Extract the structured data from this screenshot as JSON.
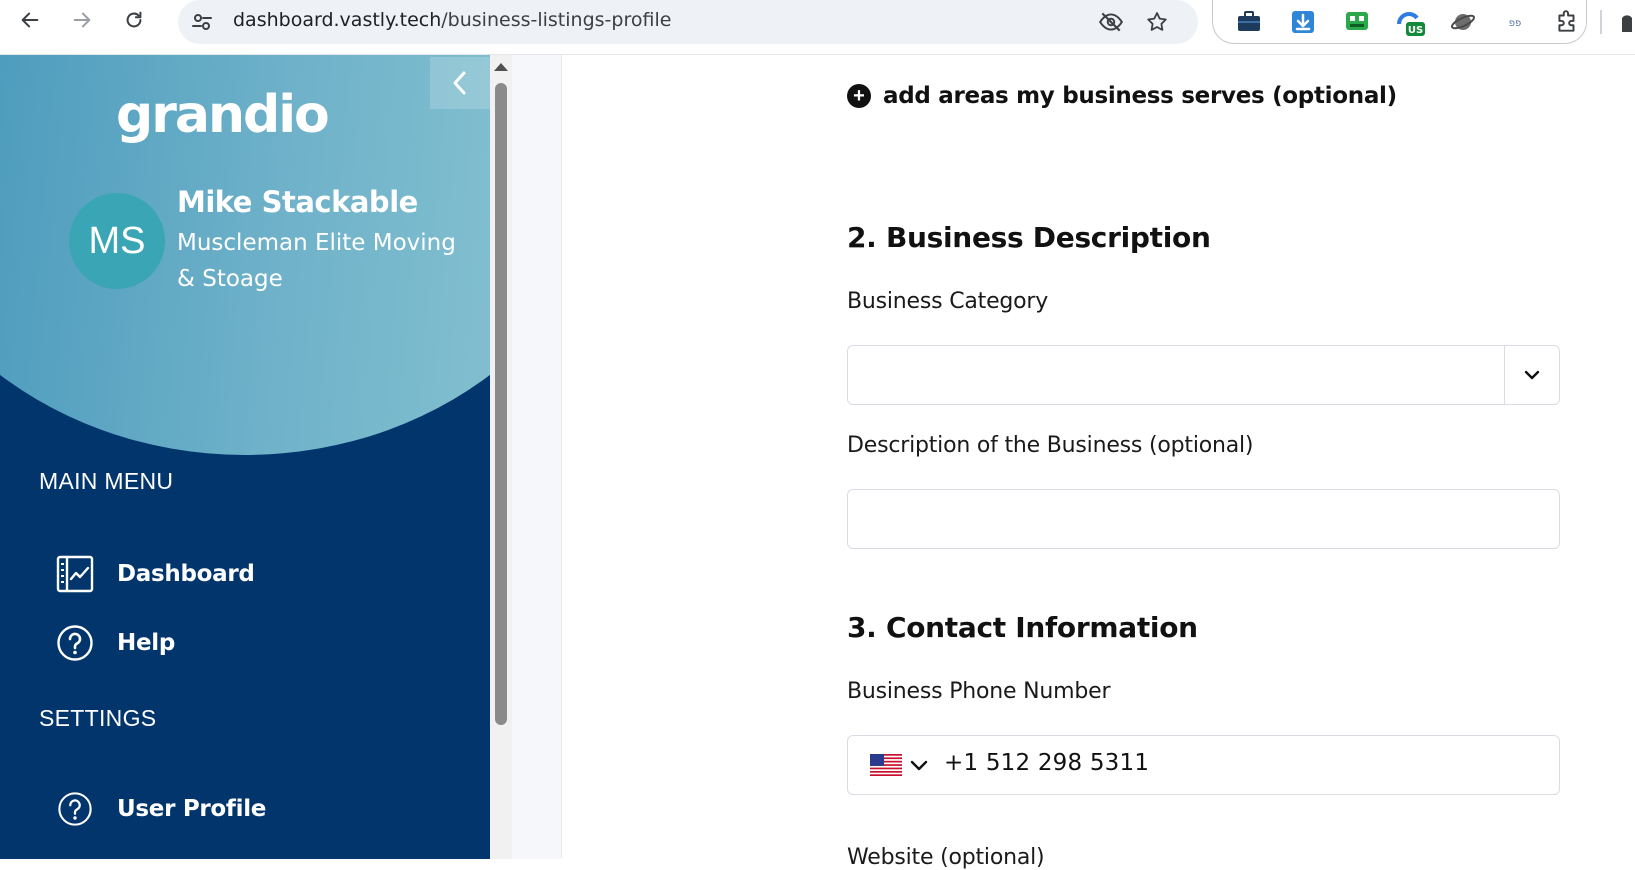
{
  "browser": {
    "url_host": "dashboard.vastly.tech",
    "url_path": "/business-listings-profile",
    "extensions": [
      "briefcase-extension",
      "download-extension",
      "green-robot-extension",
      "vpn-extension",
      "planet-extension",
      "hebrew-text-extension",
      "puzzle-extensions-menu"
    ],
    "vpn_badge": "US"
  },
  "sidebar": {
    "brand": "grandio",
    "user": {
      "initials": "MS",
      "name": "Mike Stackable",
      "company": "Muscleman Elite Moving & Stoage"
    },
    "main_menu_label": "MAIN MENU",
    "main_menu": [
      {
        "label": "Dashboard",
        "icon": "dashboard-chart-icon"
      },
      {
        "label": "Help",
        "icon": "help-circle-icon"
      }
    ],
    "settings_label": "SETTINGS",
    "settings_menu": [
      {
        "label": "User Profile",
        "icon": "help-circle-icon"
      }
    ],
    "accent_color": "#02356c",
    "hero_gradient": [
      "#3e92b8",
      "#8cc7d3"
    ]
  },
  "form": {
    "add_areas_label": "add areas my business serves (optional)",
    "section2_title": "2. Business Description",
    "category_label": "Business Category",
    "category_value": "",
    "description_label": "Description of the Business (optional)",
    "description_value": "",
    "section3_title": "3. Contact Information",
    "phone_label": "Business Phone Number",
    "phone_country": "US",
    "phone_value": "+1 512 298 5311",
    "website_label": "Website (optional)"
  }
}
